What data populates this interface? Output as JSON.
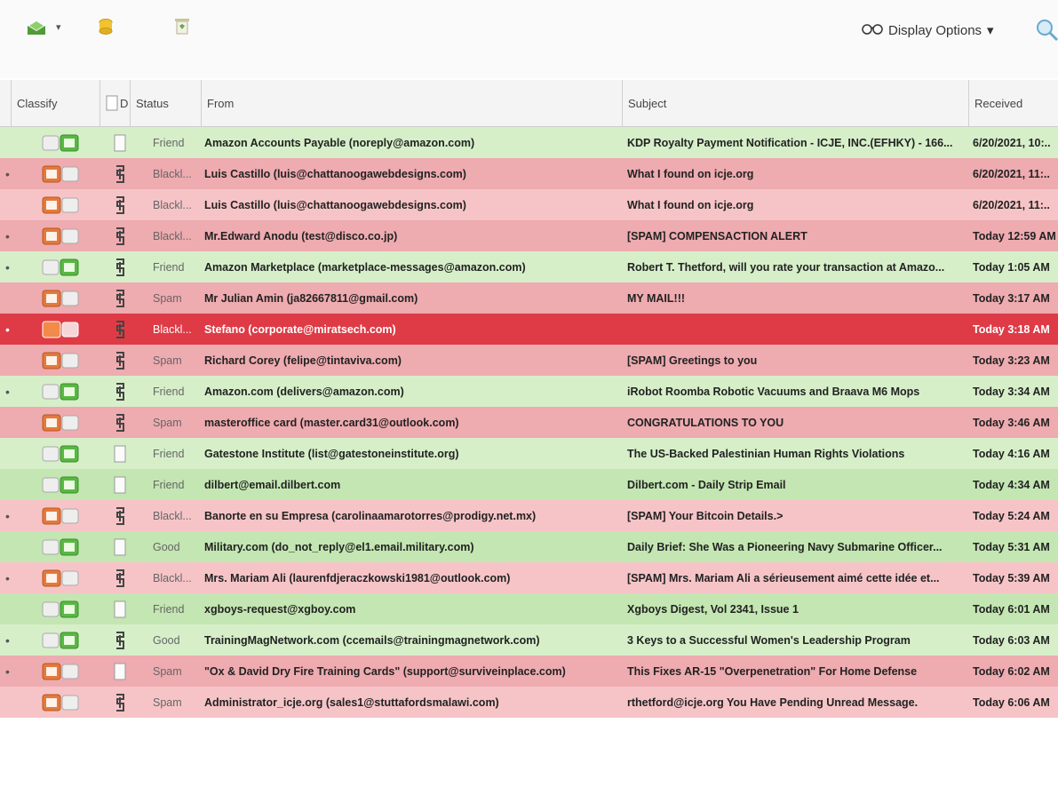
{
  "toolbar": {
    "display_options_label": "Display Options",
    "dropdown_arrow": "▾"
  },
  "columns": {
    "classify": "Classify",
    "doc": "D",
    "status": "Status",
    "from": "From",
    "subject": "Subject",
    "received": "Received"
  },
  "colors": {
    "good_row": "#d6efc9",
    "bad_row": "#f6c4c7",
    "selected_row": "#de3b46"
  },
  "rows": [
    {
      "dot": "",
      "status": "Friend",
      "from": "Amazon Accounts Payable (noreply@amazon.com)",
      "subject": "KDP Royalty Payment Notification - ICJE, INC.(EFHKY) - 166...",
      "received": "6/20/2021, 10:..",
      "kind": "friend",
      "doc": "blank",
      "cls": "good"
    },
    {
      "dot": "•",
      "status": "Blackl...",
      "from": "Luis Castillo (luis@chattanoogawebdesigns.com)",
      "subject": "What I found on icje.org",
      "received": "6/20/2021, 11:..",
      "kind": "bad",
      "doc": "clip",
      "cls": "bad"
    },
    {
      "dot": "",
      "status": "Blackl...",
      "from": "Luis Castillo (luis@chattanoogawebdesigns.com)",
      "subject": "What I found on icje.org",
      "received": "6/20/2021, 11:..",
      "kind": "bad",
      "doc": "clip",
      "cls": "bad"
    },
    {
      "dot": "•",
      "status": "Blackl...",
      "from": "Mr.Edward Anodu (test@disco.co.jp)",
      "subject": "[SPAM] COMPENSACTION ALERT",
      "received": "Today 12:59 AM",
      "kind": "bad",
      "doc": "clip",
      "cls": "bad"
    },
    {
      "dot": "•",
      "status": "Friend",
      "from": "Amazon Marketplace (marketplace-messages@amazon.com)",
      "subject": "Robert T. Thetford, will you rate your transaction at Amazo...",
      "received": "Today 1:05 AM",
      "kind": "friend",
      "doc": "clip",
      "cls": "good"
    },
    {
      "dot": "",
      "status": "Spam",
      "from": "Mr Julian Amin (ja82667811@gmail.com)",
      "subject": "MY MAIL!!!",
      "received": "Today 3:17 AM",
      "kind": "bad",
      "doc": "clip",
      "cls": "bad"
    },
    {
      "dot": "•",
      "status": "Blackl...",
      "from": "Stefano (corporate@miratsech.com)",
      "subject": "",
      "received": "Today 3:18 AM",
      "kind": "sel",
      "doc": "clip",
      "cls": "sel"
    },
    {
      "dot": "",
      "status": "Spam",
      "from": "Richard Corey (felipe@tintaviva.com)",
      "subject": "[SPAM] Greetings to you",
      "received": "Today 3:23 AM",
      "kind": "bad",
      "doc": "clip",
      "cls": "bad"
    },
    {
      "dot": "•",
      "status": "Friend",
      "from": "Amazon.com (delivers@amazon.com)",
      "subject": "iRobot Roomba Robotic Vacuums and Braava M6 Mops",
      "received": "Today 3:34 AM",
      "kind": "friend",
      "doc": "clip",
      "cls": "good"
    },
    {
      "dot": "",
      "status": "Spam",
      "from": "masteroffice card (master.card31@outlook.com)",
      "subject": "CONGRATULATIONS TO YOU",
      "received": "Today 3:46 AM",
      "kind": "bad",
      "doc": "clip",
      "cls": "bad"
    },
    {
      "dot": "",
      "status": "Friend",
      "from": "Gatestone Institute (list@gatestoneinstitute.org)",
      "subject": "The US-Backed Palestinian Human Rights Violations",
      "received": "Today 4:16 AM",
      "kind": "friend",
      "doc": "blank",
      "cls": "good"
    },
    {
      "dot": "",
      "status": "Friend",
      "from": "dilbert@email.dilbert.com",
      "subject": "Dilbert.com - Daily Strip Email",
      "received": "Today 4:34 AM",
      "kind": "friend",
      "doc": "blank",
      "cls": "good"
    },
    {
      "dot": "•",
      "status": "Blackl...",
      "from": "Banorte en su Empresa (carolinaamarotorres@prodigy.net.mx)",
      "subject": "[SPAM] Your Bitcoin Details.>",
      "received": "Today 5:24 AM",
      "kind": "bad",
      "doc": "clip",
      "cls": "bad"
    },
    {
      "dot": "",
      "status": "Good",
      "from": "Military.com (do_not_reply@el1.email.military.com)",
      "subject": "Daily Brief: She Was a Pioneering Navy Submarine Officer...",
      "received": "Today 5:31 AM",
      "kind": "good",
      "doc": "blank",
      "cls": "good"
    },
    {
      "dot": "•",
      "status": "Blackl...",
      "from": "Mrs. Mariam Ali (laurenfdjeraczkowski1981@outlook.com)",
      "subject": "[SPAM] Mrs. Mariam Ali a sérieusement aimé cette idée et...",
      "received": "Today 5:39 AM",
      "kind": "bad",
      "doc": "clip",
      "cls": "bad"
    },
    {
      "dot": "",
      "status": "Friend",
      "from": "xgboys-request@xgboy.com",
      "subject": "Xgboys Digest, Vol 2341, Issue 1",
      "received": "Today 6:01 AM",
      "kind": "friend",
      "doc": "blank",
      "cls": "good"
    },
    {
      "dot": "•",
      "status": "Good",
      "from": "TrainingMagNetwork.com (ccemails@trainingmagnetwork.com)",
      "subject": "3 Keys to a Successful Women's Leadership Program",
      "received": "Today 6:03 AM",
      "kind": "good",
      "doc": "clip",
      "cls": "good"
    },
    {
      "dot": "•",
      "status": "Spam",
      "from": "\"Ox & David Dry Fire Training Cards\" (support@surviveinplace.com)",
      "subject": "This Fixes AR-15 \"Overpenetration\" For Home Defense",
      "received": "Today 6:02 AM",
      "kind": "bad",
      "doc": "blank",
      "cls": "bad"
    },
    {
      "dot": "",
      "status": "Spam",
      "from": "Administrator_icje.org (sales1@stuttafordsmalawi.com)",
      "subject": "rthetford@icje.org You Have Pending Unread Message.",
      "received": "Today 6:06 AM",
      "kind": "bad",
      "doc": "clip",
      "cls": "bad"
    }
  ]
}
